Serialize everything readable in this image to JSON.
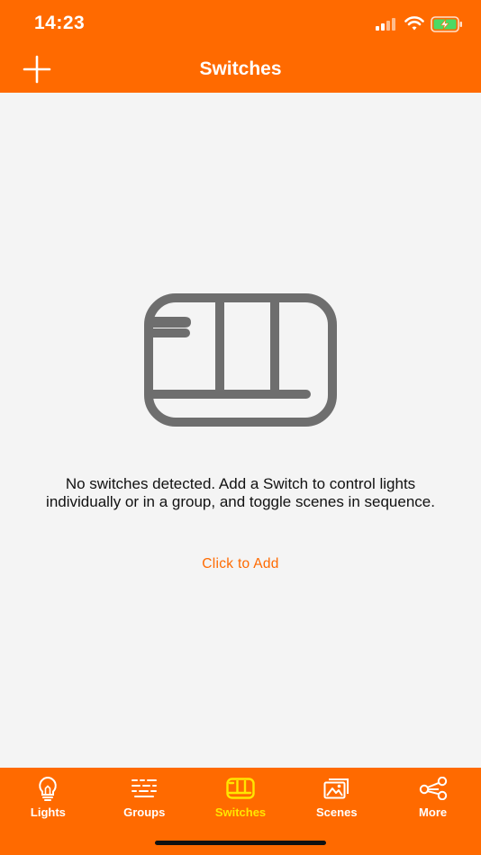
{
  "status_bar": {
    "time": "14:23",
    "icons": [
      "signal-icon",
      "wifi-icon",
      "battery-charging-icon"
    ]
  },
  "nav": {
    "title": "Switches",
    "add_icon": "plus-icon"
  },
  "empty_state": {
    "icon": "switch-icon",
    "message": "No switches detected. Add a Switch to control lights individually or in a group, and toggle scenes in sequence.",
    "action_label": "Click to Add"
  },
  "tabs": [
    {
      "label": "Lights",
      "icon": "bulb-icon",
      "active": false
    },
    {
      "label": "Groups",
      "icon": "groups-icon",
      "active": false
    },
    {
      "label": "Switches",
      "icon": "switch-icon",
      "active": true
    },
    {
      "label": "Scenes",
      "icon": "scenes-icon",
      "active": false
    },
    {
      "label": "More",
      "icon": "share-icon",
      "active": false
    }
  ],
  "colors": {
    "accent": "#ff6a00",
    "active_tab": "#ffe600",
    "background": "#f4f4f4",
    "icon_gray": "#6e6e6e"
  }
}
